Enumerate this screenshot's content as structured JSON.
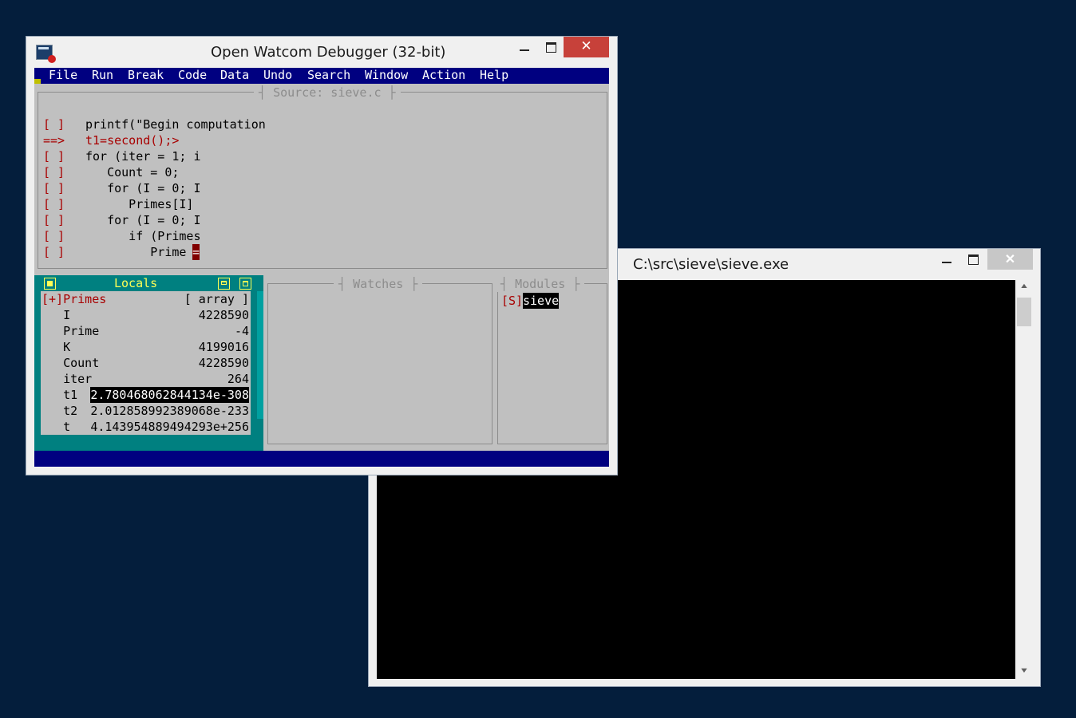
{
  "desktop": {
    "background": "#041e3c"
  },
  "console_window": {
    "title": "C:\\src\\sieve\\sieve.exe",
    "close_glyph": "✕",
    "scroll_up": "▲",
    "scroll_down": "▼"
  },
  "debugger_window": {
    "title": "Open Watcom Debugger (32-bit)",
    "close_glyph": "✕",
    "menu": [
      "File",
      "Run",
      "Break",
      "Code",
      "Data",
      "Undo",
      "Search",
      "Window",
      "Action",
      "Help"
    ],
    "source": {
      "title": "Source: sieve.c",
      "lines": [
        {
          "marker": "[ ]",
          "code": "printf(\"Begin computation",
          "current": false
        },
        {
          "marker": "==>",
          "code": "t1=second();>",
          "current": true
        },
        {
          "marker": "[ ]",
          "code": "for (iter = 1; i",
          "current": false
        },
        {
          "marker": "[ ]",
          "code": "   Count = 0;",
          "current": false
        },
        {
          "marker": "[ ]",
          "code": "   for (I = 0; I",
          "current": false
        },
        {
          "marker": "[ ]",
          "code": "      Primes[I]",
          "current": false
        },
        {
          "marker": "[ ]",
          "code": "   for (I = 0; I",
          "current": false
        },
        {
          "marker": "[ ]",
          "code": "      if (Primes",
          "current": false
        },
        {
          "marker": "[ ]",
          "code": "         Prime ",
          "current": false
        }
      ],
      "cursor_char": "="
    },
    "locals": {
      "title": "Locals",
      "rows": [
        {
          "name": "[+]Primes",
          "value": "[ array ]"
        },
        {
          "name": "   I",
          "value": "4228590"
        },
        {
          "name": "   Prime",
          "value": "-4"
        },
        {
          "name": "   K",
          "value": "4199016"
        },
        {
          "name": "   Count",
          "value": "4228590"
        },
        {
          "name": "   iter",
          "value": "264"
        },
        {
          "name": "   t1",
          "value": "2.780468062844134e-308"
        },
        {
          "name": "   t2",
          "value": "2.012858992389068e-233"
        },
        {
          "name": "   t",
          "value": "4.143954889494293e+256"
        }
      ]
    },
    "watches": {
      "title": "Watches"
    },
    "modules": {
      "title": "Modules",
      "prefix": "[S]",
      "name": "sieve"
    }
  }
}
